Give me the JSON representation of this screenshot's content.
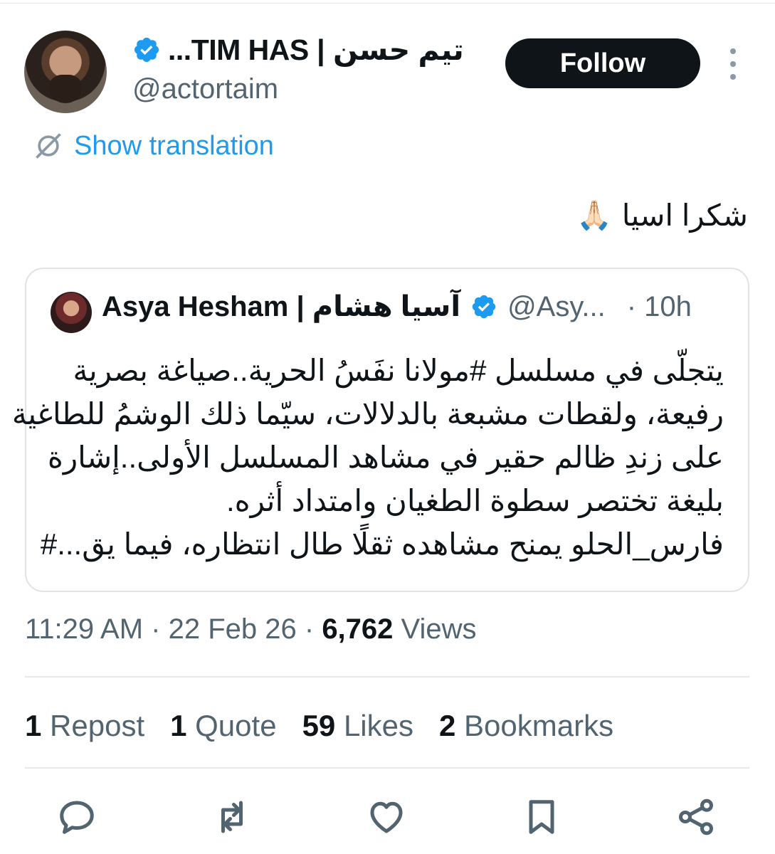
{
  "author": {
    "name": "تيم حسن | TIM HAS...",
    "handle": "@actortaim",
    "follow_label": "Follow"
  },
  "translation_label": "Show translation",
  "tweet_text": "شكرا اسيا",
  "tweet_emoji": "🙏🏻",
  "quote": {
    "name": "Asya Hesham | آسيا هشام",
    "handle": "@Asy...",
    "time": "· 10h",
    "lines": [
      "يتجلّى في مسلسل #مولانا نفَسُ الحرية..صياغة بصرية",
      "رفيعة، ولقطات مشبعة بالدلالات، سيّما ذلك الوشمُ للطاغية",
      "على زندِ ظالم حقير في مشاهد المسلسل الأولى..إشارة",
      "بليغة تختصر سطوة الطغيان وامتداد أثره.",
      "فارس_الحلو يمنح مشاهده ثقلًا طال انتظاره، فيما يق...#"
    ]
  },
  "meta": {
    "time": "11:29 AM",
    "date": "22 Feb 26",
    "views_count": "6,762",
    "views_label": "Views"
  },
  "stats": {
    "reposts_count": "1",
    "reposts_label": "Repost",
    "quotes_count": "1",
    "quotes_label": "Quote",
    "likes_count": "59",
    "likes_label": "Likes",
    "bookmarks_count": "2",
    "bookmarks_label": "Bookmarks"
  },
  "icons": [
    "reply-icon",
    "repost-icon",
    "like-icon",
    "bookmark-icon",
    "share-icon"
  ],
  "colors": {
    "accent": "#1d9bf0",
    "text": "#0f1419",
    "secondary": "#536471"
  }
}
